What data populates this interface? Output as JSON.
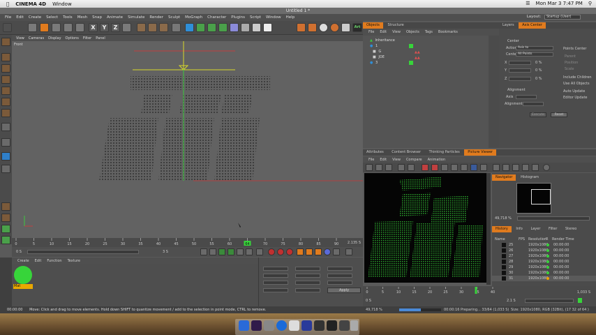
{
  "macbar": {
    "app_name": "CINEMA 4D",
    "window_menu": "Window",
    "clock": "Mon Mar 3  7:47 PM"
  },
  "window": {
    "title": "Untitled 1 *"
  },
  "menu": {
    "items": [
      "File",
      "Edit",
      "Create",
      "Select",
      "Tools",
      "Mesh",
      "Snap",
      "Animate",
      "Simulate",
      "Render",
      "Sculpt",
      "MoGraph",
      "Character",
      "Plugins",
      "Script",
      "Window",
      "Help"
    ],
    "layout_label": "Layout:",
    "layout_value": "Startup (User)"
  },
  "toolbar": {
    "x": "X",
    "y": "Y",
    "z": "Z",
    "art": "Art"
  },
  "viewport": {
    "menu": [
      "View",
      "Cameras",
      "Display",
      "Options",
      "Filter",
      "Panel"
    ],
    "label": "Front"
  },
  "timeline": {
    "ticks": [
      "0",
      "5",
      "10",
      "15",
      "20",
      "25",
      "30",
      "35",
      "40",
      "45",
      "50",
      "55",
      "60",
      "64",
      "70",
      "75",
      "80",
      "85",
      "90"
    ],
    "current_frame": "64",
    "right_field": "2.135 S",
    "start_field": "0 S",
    "end_field": "3 S"
  },
  "material": {
    "menu": [
      "Create",
      "Edit",
      "Function",
      "Texture"
    ],
    "mat_label": "Mat"
  },
  "coords": {
    "apply_label": "Apply"
  },
  "objects": {
    "tabs": [
      "Objects",
      "Structure"
    ],
    "menu": [
      "File",
      "Edit",
      "View",
      "Objects",
      "Tags",
      "Bookmarks"
    ],
    "rows": [
      "Inheritance",
      "1",
      "G",
      "JOE",
      "3"
    ]
  },
  "attributes": {
    "tabs": [
      "Layers",
      "Axis Center"
    ],
    "center_label": "Center",
    "action_label": "Action",
    "action_value": "Axis to",
    "center_field_label": "Center",
    "center_field_value": "All Points",
    "x_label": "X",
    "y_label": "Y",
    "z_label": "Z",
    "pct_value": "0 %",
    "points_center": "Points Center",
    "parent": "Parent",
    "position": "Position",
    "scale": "Scale",
    "include_children": "Include Children",
    "use_all_objects": "Use All Objects",
    "auto_update": "Auto Update",
    "editor_update": "Editor Update",
    "alignment": "Alignment",
    "axis_label": "Axis",
    "alignment_label": "Alignment",
    "execute": "Execute",
    "reset": "Reset"
  },
  "picture_viewer": {
    "tabs": [
      "Attributes",
      "Content Browser",
      "Thinking Particles",
      "Picture Viewer"
    ],
    "menu": [
      "File",
      "Edit",
      "View",
      "Compare",
      "Animation"
    ],
    "nav_tabs": [
      "Navigator",
      "Histogram"
    ],
    "zoom": "49,718 %",
    "hist_tabs": [
      "History",
      "Info",
      "Layer",
      "Filter",
      "Stereo"
    ],
    "table_headers": [
      "Name",
      "FPS",
      "Resolution",
      "R",
      "Render Time"
    ],
    "rows": [
      {
        "name": "25",
        "res": "1920x1080",
        "time": "00:00:00"
      },
      {
        "name": "26",
        "res": "1920x1080",
        "time": "00:00:00"
      },
      {
        "name": "27",
        "res": "1920x1080",
        "time": "00:00:00"
      },
      {
        "name": "28",
        "res": "1920x1080",
        "time": "00:00:00"
      },
      {
        "name": "29",
        "res": "1920x1080",
        "time": "00:00:00"
      },
      {
        "name": "30",
        "res": "1920x1080",
        "time": "00:00:00"
      },
      {
        "name": "31",
        "res": "1920x1080",
        "time": "00:00:00"
      }
    ],
    "ticks": [
      "0",
      "5",
      "10",
      "15",
      "20",
      "25",
      "30",
      "35",
      "40"
    ],
    "frame_field": "1,033 S",
    "left_field": "0 S",
    "mid_field": "2.1 S",
    "status_zoom": "49,718 %",
    "progress_text": "00:00:16 Preparing... 33/64 (1,033 S)",
    "size_text": "Size: 1920x1080, RGB (32Bit), (17 32 of 64 )"
  },
  "status": {
    "time": "00:00:00",
    "message": "Move: Click and drag to move elements. Hold down SHIFT to quantize movement / add to the selection in point mode, CTRL to remove."
  },
  "colors": {
    "accent": "#e07b1e",
    "green": "#37d43a",
    "orange": "#f0a000",
    "red": "#d03030"
  }
}
